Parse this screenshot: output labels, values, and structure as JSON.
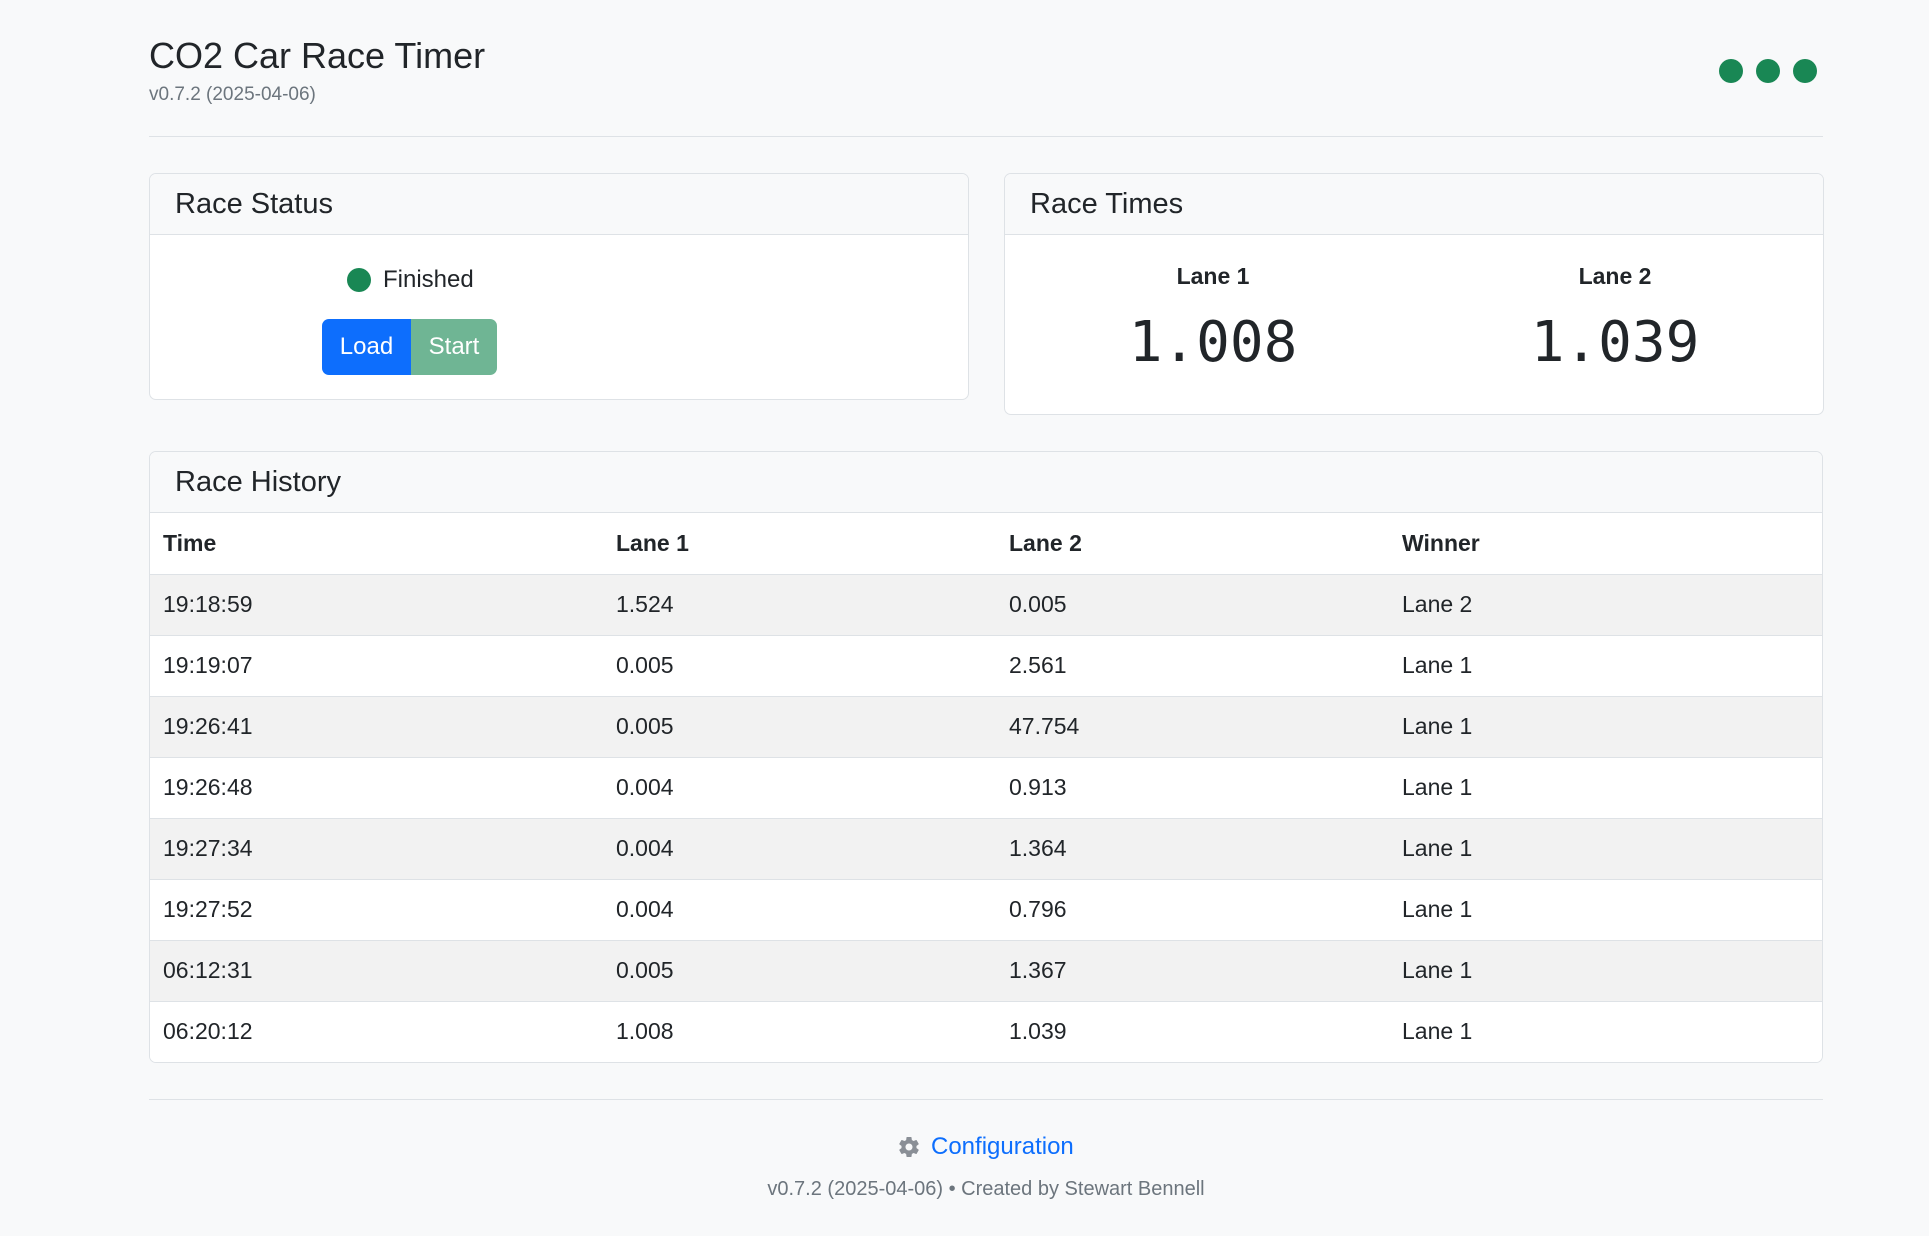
{
  "header": {
    "title": "CO2 Car Race Timer",
    "version": "v0.7.2 (2025-04-06)",
    "indicator_color": "#198754"
  },
  "race_status": {
    "title": "Race Status",
    "status_text": "Finished",
    "status_color": "#198754",
    "load_label": "Load",
    "start_label": "Start"
  },
  "race_times": {
    "title": "Race Times",
    "lane1_label": "Lane 1",
    "lane1_time": "1.008",
    "lane2_label": "Lane 2",
    "lane2_time": "1.039"
  },
  "race_history": {
    "title": "Race History",
    "columns": [
      "Time",
      "Lane 1",
      "Lane 2",
      "Winner"
    ],
    "rows": [
      [
        "19:18:59",
        "1.524",
        "0.005",
        "Lane 2"
      ],
      [
        "19:19:07",
        "0.005",
        "2.561",
        "Lane 1"
      ],
      [
        "19:26:41",
        "0.005",
        "47.754",
        "Lane 1"
      ],
      [
        "19:26:48",
        "0.004",
        "0.913",
        "Lane 1"
      ],
      [
        "19:27:34",
        "0.004",
        "1.364",
        "Lane 1"
      ],
      [
        "19:27:52",
        "0.004",
        "0.796",
        "Lane 1"
      ],
      [
        "06:12:31",
        "0.005",
        "1.367",
        "Lane 1"
      ],
      [
        "06:20:12",
        "1.008",
        "1.039",
        "Lane 1"
      ]
    ]
  },
  "footer": {
    "config_label": "Configuration",
    "config_icon": "gear-icon",
    "credit": "v0.7.2 (2025-04-06) • Created by Stewart Bennell"
  }
}
